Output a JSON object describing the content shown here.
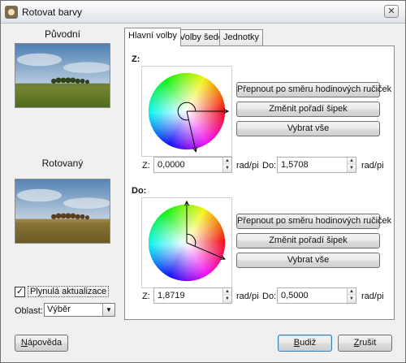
{
  "window": {
    "title": "Rotovat barvy",
    "close_glyph": "✕",
    "icon": "app-icon"
  },
  "previews": {
    "original_label": "Původní",
    "rotated_label": "Rotovaný"
  },
  "options": {
    "live_update_label": "Plynulá aktualizace",
    "live_update_checked": true,
    "check_glyph": "✓",
    "area_label": "Oblast:",
    "area_value": "Výběr",
    "dropdown_glyph": "▼"
  },
  "tabs": [
    {
      "label": "Hlavní volby",
      "active": true
    },
    {
      "label": "Volby šedé",
      "active": false
    },
    {
      "label": "Jednotky",
      "active": false
    }
  ],
  "from_section": {
    "title": "Z:",
    "buttons": {
      "switch": "Přepnout po směru hodinových ručiček",
      "swap": "Změnit pořadí šipek",
      "select_all": "Vybrat vše"
    },
    "z_label": "Z:",
    "z_value": "0,0000",
    "z_unit": "rad/pi",
    "do_label": "Do:",
    "do_value": "1,5708",
    "do_unit": "rad/pi"
  },
  "to_section": {
    "title": "Do:",
    "buttons": {
      "switch": "Přepnout po směru hodinových ručiček",
      "swap": "Změnit pořadí šipek",
      "select_all": "Vybrat vše"
    },
    "z_label": "Z:",
    "z_value": "1,8719",
    "z_unit": "rad/pi",
    "do_label": "Do:",
    "do_value": "0,5000",
    "do_unit": "rad/pi"
  },
  "spin_glyphs": {
    "up": "▲",
    "down": "▼"
  },
  "footer": {
    "help_label_accel": "N",
    "help_label_rest": "ápověda",
    "ok_label_accel": "B",
    "ok_label_rest": "udiž",
    "cancel_label_accel": "Z",
    "cancel_label_rest": "rušit"
  }
}
